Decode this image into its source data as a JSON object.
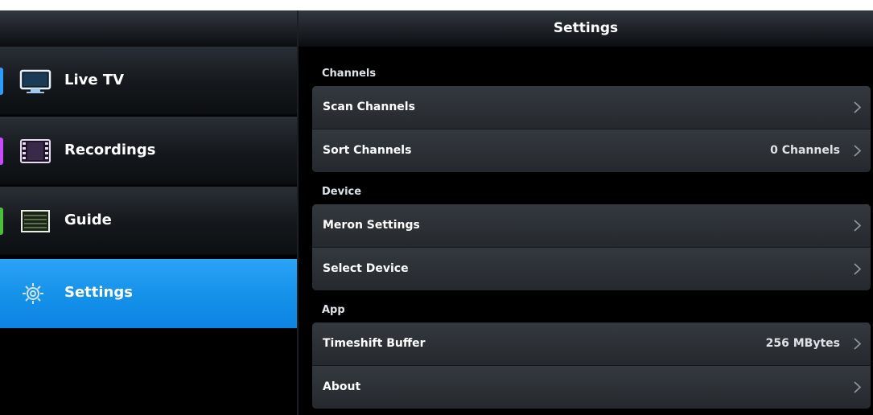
{
  "sidebar": {
    "items": [
      {
        "label": "Live TV",
        "icon": "tv-icon",
        "accent": "#2d9bff",
        "active": false
      },
      {
        "label": "Recordings",
        "icon": "film-icon",
        "accent": "#c84bff",
        "active": false
      },
      {
        "label": "Guide",
        "icon": "guide-icon",
        "accent": "#4bbf3a",
        "active": false
      },
      {
        "label": "Settings",
        "icon": "gear-icon",
        "accent": "#1a8fe8",
        "active": true
      }
    ]
  },
  "header": {
    "title": "Settings"
  },
  "sections": [
    {
      "label": "Channels",
      "rows": [
        {
          "label": "Scan Channels",
          "value": ""
        },
        {
          "label": "Sort Channels",
          "value": "0 Channels"
        }
      ]
    },
    {
      "label": "Device",
      "rows": [
        {
          "label": "Meron Settings",
          "value": ""
        },
        {
          "label": "Select Device",
          "value": ""
        }
      ]
    },
    {
      "label": "App",
      "rows": [
        {
          "label": "Timeshift Buffer",
          "value": "256 MBytes"
        },
        {
          "label": "About",
          "value": ""
        }
      ]
    }
  ],
  "colors": {
    "active": "#1a8fe8",
    "background": "#000000"
  }
}
